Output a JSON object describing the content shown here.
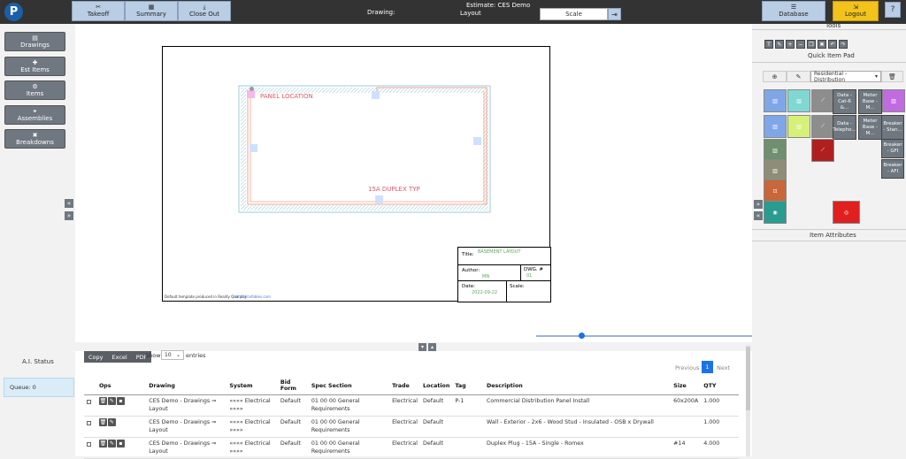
{
  "header": {
    "takeoff": "Takeoff",
    "summary": "Summary",
    "close_out": "Close Out",
    "drawing_label": "Drawing:",
    "estimate": "Estimate: CES Demo",
    "layout": "Layout",
    "scale": "Scale",
    "database": "Database",
    "logout": "Logout"
  },
  "sidebar": {
    "items": [
      {
        "label": "Drawings",
        "icon": "drawings-icon"
      },
      {
        "label": "Est Items",
        "icon": "est-items-icon"
      },
      {
        "label": "Items",
        "icon": "items-icon"
      },
      {
        "label": "Assemblies",
        "icon": "assemblies-icon"
      },
      {
        "label": "Breakdowns",
        "icon": "breakdowns-icon"
      }
    ],
    "ai_status": "A.I. Status",
    "queue": "Queue: 0"
  },
  "drawing": {
    "panel_location": "PANEL LOCATION",
    "duplex": "15A DUPLEX TYP",
    "title_label": "Title:",
    "title_value": "BASEMENT LAYOUT",
    "author_label": "Author:",
    "author_value": "MN",
    "dwg_label": "DWG. #",
    "dwg_value": "01",
    "date_label": "Date:",
    "date_value": "2022-09-22",
    "scale_label": "Scale:",
    "footer_text": "Default template produced in Reality Quantity",
    "footer_link": "https://cefables.com"
  },
  "tools": {
    "title": "Tools",
    "quick_item_pad": "Quick Item Pad",
    "category_select": "Residential - Distribution",
    "item_attributes": "Item Attributes",
    "tiles": [
      {
        "label": "Data - Cat-6 &..."
      },
      {
        "label": "Meter Base - M..."
      },
      {
        "label": "Data - Telepho..."
      },
      {
        "label": "Meter Base - M..."
      },
      {
        "label": "Breaker - Stan..."
      },
      {
        "label": "Breaker - GFI"
      },
      {
        "label": "Breaker - AFI"
      }
    ]
  },
  "table": {
    "buttons": [
      "Copy",
      "Excel",
      "PDF"
    ],
    "show": "Show",
    "entries_value": "10",
    "entries": "entries",
    "previous": "Previous",
    "page": "1",
    "next": "Next",
    "columns": [
      "Ops",
      "Drawing",
      "System",
      "Bid Form",
      "Spec Section",
      "Trade",
      "Location",
      "Tag",
      "Description",
      "Size",
      "QTY"
    ],
    "rows": [
      {
        "drawing": "CES Demo - Drawings ⇒ Layout",
        "system": "«««« Electrical »»»»",
        "bid_form": "Default",
        "spec": "01 00 00 General Requirements",
        "trade": "Electrical",
        "location": "Default",
        "tag": "P-1",
        "description": "Commercial Distribution Panel Install",
        "size": "60x200A",
        "qty": "1.000"
      },
      {
        "drawing": "CES Demo - Drawings ⇒ Layout",
        "system": "«««« Electrical »»»»",
        "bid_form": "Default",
        "spec": "01 00 00 General Requirements",
        "trade": "Electrical",
        "location": "Default",
        "tag": "",
        "description": "Wall - Exterior - 2x6 - Wood Stud - Insulated - OSB x Drywall",
        "size": "",
        "qty": "1.000"
      },
      {
        "drawing": "CES Demo - Drawings ⇒ Layout",
        "system": "«««« Electrical »»»»",
        "bid_form": "Default",
        "spec": "01 00 00 General Requirements",
        "trade": "Electrical",
        "location": "Default",
        "tag": "",
        "description": "Duplex Plug - 15A - Single - Romex",
        "size": "#14",
        "qty": "4.000"
      }
    ]
  },
  "colors": {
    "topbar": "#333333",
    "nav": "#b9cde4",
    "logout": "#f3c21b",
    "page_active": "#1a73e8"
  }
}
